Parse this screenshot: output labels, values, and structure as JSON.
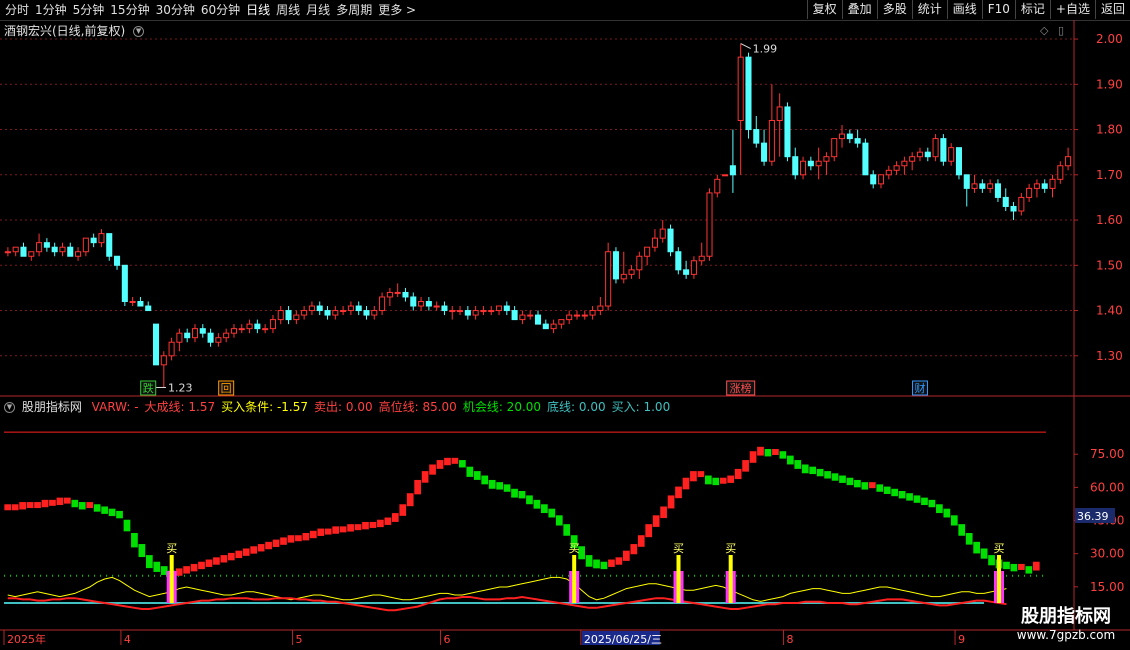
{
  "toolbar": {
    "periods": [
      "分时",
      "1分钟",
      "5分钟",
      "15分钟",
      "30分钟",
      "60分钟",
      "日线",
      "周线",
      "月线",
      "多周期",
      "更多 >"
    ],
    "active_period": "日线",
    "buttons": [
      "复权",
      "叠加",
      "多股",
      "统计",
      "画线",
      "F10",
      "标记",
      "+自选",
      "返回"
    ]
  },
  "stock_title": "酒钢宏兴(日线,前复权)",
  "colors": {
    "up": "#ff3333",
    "down": "#54ffff",
    "axis": "#b3282d",
    "grid": "#7a1a1a",
    "yellow": "#ffff00",
    "green": "#00e000",
    "red": "#ff2020",
    "magenta": "#ff33ff",
    "teal": "#40c0c0"
  },
  "indicator": {
    "name": "股朋指标网",
    "values": [
      {
        "text": "VARW: -",
        "color": "#ff4040"
      },
      {
        "text": "大成线: 1.57",
        "color": "#ff4040"
      },
      {
        "text": "买入条件: -1.57",
        "color": "#ffff00"
      },
      {
        "text": "卖出: 0.00",
        "color": "#ff4040"
      },
      {
        "text": "高位线: 85.00",
        "color": "#ff4040"
      },
      {
        "text": "机会线: 20.00",
        "color": "#00e000"
      },
      {
        "text": "底线: 0.00",
        "color": "#40c0c0"
      },
      {
        "text": "买入: 1.00",
        "color": "#40c0c0"
      }
    ]
  },
  "logo": {
    "line1": "股朋指标网",
    "line2": "www.7gpzb.com"
  },
  "chart_data": [
    {
      "type": "candlestick",
      "title": "酒钢宏兴(日线,前复权)",
      "ylim": [
        1.22,
        2.02
      ],
      "y_ticks": [
        "2.00",
        "1.90",
        "1.80",
        "1.70",
        "1.60",
        "1.50",
        "1.40",
        "1.30"
      ],
      "annotations": [
        {
          "text": "1.99",
          "x_index": 94
        },
        {
          "text": "1.23",
          "x_index": 19
        }
      ],
      "event_tags": [
        {
          "text": "跌",
          "x_index": 18,
          "color": "#33cc33"
        },
        {
          "text": "回",
          "x_index": 28,
          "color": "#ff9900"
        },
        {
          "text": "涨榜",
          "x_index": 94,
          "color": "#ff5050"
        },
        {
          "text": "财",
          "x_index": 117,
          "color": "#3399ff"
        }
      ],
      "ohlc": [
        [
          1.53,
          1.54,
          1.52,
          1.53
        ],
        [
          1.53,
          1.54,
          1.52,
          1.54
        ],
        [
          1.54,
          1.55,
          1.52,
          1.52
        ],
        [
          1.52,
          1.53,
          1.51,
          1.53
        ],
        [
          1.53,
          1.57,
          1.52,
          1.55
        ],
        [
          1.55,
          1.56,
          1.53,
          1.54
        ],
        [
          1.54,
          1.55,
          1.52,
          1.53
        ],
        [
          1.53,
          1.55,
          1.52,
          1.54
        ],
        [
          1.54,
          1.55,
          1.52,
          1.52
        ],
        [
          1.52,
          1.54,
          1.51,
          1.53
        ],
        [
          1.53,
          1.56,
          1.52,
          1.56
        ],
        [
          1.56,
          1.57,
          1.54,
          1.55
        ],
        [
          1.55,
          1.58,
          1.54,
          1.57
        ],
        [
          1.57,
          1.57,
          1.51,
          1.52
        ],
        [
          1.52,
          1.52,
          1.49,
          1.5
        ],
        [
          1.5,
          1.5,
          1.41,
          1.42
        ],
        [
          1.42,
          1.43,
          1.41,
          1.42
        ],
        [
          1.42,
          1.43,
          1.41,
          1.41
        ],
        [
          1.41,
          1.42,
          1.4,
          1.4
        ],
        [
          1.37,
          1.37,
          1.28,
          1.28
        ],
        [
          1.28,
          1.31,
          1.23,
          1.3
        ],
        [
          1.3,
          1.34,
          1.29,
          1.33
        ],
        [
          1.33,
          1.36,
          1.31,
          1.35
        ],
        [
          1.35,
          1.36,
          1.33,
          1.34
        ],
        [
          1.34,
          1.37,
          1.33,
          1.36
        ],
        [
          1.36,
          1.37,
          1.34,
          1.35
        ],
        [
          1.35,
          1.36,
          1.32,
          1.33
        ],
        [
          1.33,
          1.35,
          1.32,
          1.34
        ],
        [
          1.34,
          1.36,
          1.33,
          1.35
        ],
        [
          1.35,
          1.37,
          1.34,
          1.36
        ],
        [
          1.36,
          1.37,
          1.35,
          1.36
        ],
        [
          1.36,
          1.38,
          1.35,
          1.37
        ],
        [
          1.37,
          1.38,
          1.35,
          1.36
        ],
        [
          1.36,
          1.37,
          1.35,
          1.36
        ],
        [
          1.36,
          1.39,
          1.35,
          1.38
        ],
        [
          1.38,
          1.41,
          1.37,
          1.4
        ],
        [
          1.4,
          1.41,
          1.37,
          1.38
        ],
        [
          1.38,
          1.4,
          1.37,
          1.39
        ],
        [
          1.39,
          1.41,
          1.38,
          1.4
        ],
        [
          1.4,
          1.42,
          1.39,
          1.41
        ],
        [
          1.41,
          1.42,
          1.39,
          1.4
        ],
        [
          1.4,
          1.41,
          1.38,
          1.39
        ],
        [
          1.39,
          1.41,
          1.38,
          1.4
        ],
        [
          1.4,
          1.41,
          1.39,
          1.4
        ],
        [
          1.4,
          1.42,
          1.39,
          1.41
        ],
        [
          1.41,
          1.42,
          1.39,
          1.4
        ],
        [
          1.4,
          1.41,
          1.38,
          1.39
        ],
        [
          1.39,
          1.41,
          1.38,
          1.4
        ],
        [
          1.4,
          1.44,
          1.39,
          1.43
        ],
        [
          1.43,
          1.45,
          1.41,
          1.44
        ],
        [
          1.44,
          1.46,
          1.43,
          1.44
        ],
        [
          1.44,
          1.45,
          1.42,
          1.43
        ],
        [
          1.43,
          1.44,
          1.4,
          1.41
        ],
        [
          1.41,
          1.43,
          1.4,
          1.42
        ],
        [
          1.42,
          1.43,
          1.4,
          1.41
        ],
        [
          1.41,
          1.42,
          1.4,
          1.41
        ],
        [
          1.41,
          1.42,
          1.39,
          1.4
        ],
        [
          1.4,
          1.41,
          1.38,
          1.4
        ],
        [
          1.4,
          1.41,
          1.39,
          1.4
        ],
        [
          1.4,
          1.41,
          1.38,
          1.39
        ],
        [
          1.39,
          1.41,
          1.38,
          1.4
        ],
        [
          1.4,
          1.41,
          1.39,
          1.4
        ],
        [
          1.4,
          1.41,
          1.39,
          1.4
        ],
        [
          1.4,
          1.41,
          1.39,
          1.41
        ],
        [
          1.41,
          1.42,
          1.39,
          1.4
        ],
        [
          1.4,
          1.41,
          1.38,
          1.38
        ],
        [
          1.38,
          1.4,
          1.37,
          1.39
        ],
        [
          1.39,
          1.4,
          1.38,
          1.39
        ],
        [
          1.39,
          1.4,
          1.37,
          1.37
        ],
        [
          1.37,
          1.38,
          1.36,
          1.36
        ],
        [
          1.36,
          1.38,
          1.35,
          1.37
        ],
        [
          1.37,
          1.38,
          1.36,
          1.38
        ],
        [
          1.38,
          1.4,
          1.37,
          1.39
        ],
        [
          1.39,
          1.4,
          1.38,
          1.39
        ],
        [
          1.39,
          1.4,
          1.38,
          1.39
        ],
        [
          1.39,
          1.41,
          1.38,
          1.4
        ],
        [
          1.4,
          1.43,
          1.39,
          1.41
        ],
        [
          1.41,
          1.55,
          1.4,
          1.53
        ],
        [
          1.53,
          1.54,
          1.46,
          1.47
        ],
        [
          1.47,
          1.53,
          1.46,
          1.48
        ],
        [
          1.48,
          1.5,
          1.47,
          1.49
        ],
        [
          1.49,
          1.53,
          1.47,
          1.52
        ],
        [
          1.52,
          1.54,
          1.5,
          1.54
        ],
        [
          1.54,
          1.58,
          1.53,
          1.56
        ],
        [
          1.56,
          1.6,
          1.55,
          1.58
        ],
        [
          1.58,
          1.59,
          1.52,
          1.53
        ],
        [
          1.53,
          1.54,
          1.48,
          1.49
        ],
        [
          1.49,
          1.51,
          1.47,
          1.48
        ],
        [
          1.48,
          1.52,
          1.47,
          1.51
        ],
        [
          1.51,
          1.55,
          1.5,
          1.52
        ],
        [
          1.52,
          1.67,
          1.51,
          1.66
        ],
        [
          1.66,
          1.7,
          1.65,
          1.69
        ],
        [
          1.7,
          1.7,
          1.7,
          1.7
        ],
        [
          1.72,
          1.8,
          1.66,
          1.7
        ],
        [
          1.82,
          1.99,
          1.7,
          1.96
        ],
        [
          1.96,
          1.97,
          1.78,
          1.8
        ],
        [
          1.8,
          1.83,
          1.76,
          1.77
        ],
        [
          1.77,
          1.8,
          1.72,
          1.73
        ],
        [
          1.73,
          1.9,
          1.72,
          1.82
        ],
        [
          1.82,
          1.88,
          1.74,
          1.85
        ],
        [
          1.85,
          1.86,
          1.73,
          1.74
        ],
        [
          1.74,
          1.76,
          1.69,
          1.7
        ],
        [
          1.7,
          1.74,
          1.69,
          1.73
        ],
        [
          1.73,
          1.74,
          1.71,
          1.72
        ],
        [
          1.72,
          1.76,
          1.69,
          1.73
        ],
        [
          1.73,
          1.75,
          1.7,
          1.74
        ],
        [
          1.74,
          1.78,
          1.73,
          1.78
        ],
        [
          1.78,
          1.81,
          1.76,
          1.79
        ],
        [
          1.79,
          1.8,
          1.77,
          1.78
        ],
        [
          1.78,
          1.8,
          1.76,
          1.77
        ],
        [
          1.77,
          1.78,
          1.7,
          1.7
        ],
        [
          1.7,
          1.71,
          1.67,
          1.68
        ],
        [
          1.68,
          1.7,
          1.67,
          1.7
        ],
        [
          1.7,
          1.72,
          1.69,
          1.71
        ],
        [
          1.71,
          1.73,
          1.7,
          1.72
        ],
        [
          1.72,
          1.74,
          1.7,
          1.73
        ],
        [
          1.73,
          1.75,
          1.71,
          1.74
        ],
        [
          1.74,
          1.76,
          1.73,
          1.75
        ],
        [
          1.75,
          1.76,
          1.73,
          1.74
        ],
        [
          1.74,
          1.79,
          1.73,
          1.78
        ],
        [
          1.78,
          1.79,
          1.72,
          1.73
        ],
        [
          1.73,
          1.77,
          1.72,
          1.76
        ],
        [
          1.76,
          1.76,
          1.69,
          1.7
        ],
        [
          1.7,
          1.7,
          1.63,
          1.67
        ],
        [
          1.67,
          1.7,
          1.66,
          1.68
        ],
        [
          1.68,
          1.69,
          1.66,
          1.67
        ],
        [
          1.67,
          1.69,
          1.66,
          1.68
        ],
        [
          1.68,
          1.69,
          1.64,
          1.65
        ],
        [
          1.65,
          1.67,
          1.62,
          1.63
        ],
        [
          1.63,
          1.64,
          1.6,
          1.62
        ],
        [
          1.62,
          1.66,
          1.61,
          1.65
        ],
        [
          1.65,
          1.68,
          1.64,
          1.67
        ],
        [
          1.67,
          1.69,
          1.65,
          1.68
        ],
        [
          1.68,
          1.69,
          1.66,
          1.67
        ],
        [
          1.67,
          1.7,
          1.65,
          1.69
        ],
        [
          1.69,
          1.73,
          1.68,
          1.72
        ],
        [
          1.72,
          1.76,
          1.71,
          1.74
        ]
      ]
    },
    {
      "type": "indicator",
      "name": "股朋指标网",
      "ylim": [
        0,
        95
      ],
      "y_ticks": [
        "75.00",
        "60.00",
        "45.00",
        "30.00",
        "15.00"
      ],
      "current_value_label": "36.39",
      "reference_lines": [
        {
          "name": "高位线",
          "value": 85
        },
        {
          "name": "机会线",
          "value": 20
        },
        {
          "name": "底线",
          "value": 0
        }
      ],
      "signal_label": "买",
      "buy_signals": [
        22,
        76,
        90,
        97,
        133
      ],
      "x_labels": [
        {
          "text": "2025年",
          "x_index": 0
        },
        {
          "text": "4",
          "x_index": 15
        },
        {
          "text": "5",
          "x_index": 37
        },
        {
          "text": "6",
          "x_index": 56
        },
        {
          "text": "2025/06/25/三",
          "x_index": 74
        },
        {
          "text": "8",
          "x_index": 100
        },
        {
          "text": "9",
          "x_index": 122
        }
      ],
      "main_line": [
        51,
        51,
        52,
        52,
        52,
        53,
        53,
        54,
        54,
        53,
        52,
        52,
        51,
        50,
        49,
        48,
        44,
        38,
        33,
        28,
        25,
        23,
        21,
        22,
        23,
        24,
        25,
        26,
        27,
        28,
        29,
        30,
        31,
        32,
        33,
        34,
        35,
        36,
        37,
        37,
        38,
        39,
        40,
        40,
        41,
        41,
        42,
        42,
        43,
        43,
        44,
        45,
        47,
        51,
        56,
        62,
        66,
        69,
        71,
        72,
        72,
        71,
        68,
        66,
        64,
        62,
        61,
        60,
        58,
        57,
        55,
        53,
        51,
        49,
        46,
        42,
        37,
        32,
        28,
        26,
        25,
        26,
        27,
        30,
        33,
        37,
        42,
        46,
        50,
        55,
        59,
        63,
        66,
        66,
        64,
        63,
        63,
        64,
        67,
        71,
        75,
        77,
        76,
        76,
        75,
        73,
        71,
        69,
        68,
        67,
        66,
        65,
        64,
        63,
        62,
        61,
        61,
        60,
        59,
        58,
        57,
        56,
        55,
        54,
        53,
        51,
        49,
        46,
        42,
        38,
        34,
        31,
        28,
        26,
        25,
        24,
        24,
        23,
        25
      ],
      "yellow_line": [
        5,
        4,
        5,
        6,
        7,
        6,
        5,
        4,
        5,
        6,
        8,
        10,
        13,
        15,
        16,
        14,
        11,
        8,
        6,
        4,
        5,
        6,
        7,
        9,
        10,
        9,
        8,
        7,
        6,
        5,
        5,
        6,
        7,
        7,
        6,
        5,
        4,
        3,
        2,
        3,
        4,
        5,
        5,
        4,
        3,
        2,
        2,
        3,
        4,
        5,
        5,
        4,
        3,
        2,
        2,
        3,
        4,
        5,
        6,
        6,
        5,
        5,
        6,
        7,
        8,
        9,
        10,
        10,
        11,
        12,
        13,
        14,
        15,
        16,
        16,
        15,
        12,
        8,
        4,
        2,
        3,
        5,
        7,
        9,
        10,
        11,
        12,
        12,
        11,
        10,
        9,
        8,
        8,
        9,
        10,
        11,
        10,
        8,
        6,
        4,
        2,
        1,
        2,
        3,
        4,
        6,
        7,
        8,
        9,
        9,
        8,
        7,
        6,
        6,
        7,
        8,
        9,
        10,
        10,
        9,
        8,
        7,
        6,
        5,
        4,
        4,
        5,
        6,
        7,
        7,
        6,
        6,
        7,
        8,
        9
      ],
      "red_line": [
        1,
        1,
        2,
        2,
        3,
        3,
        2,
        2,
        1,
        1,
        2,
        3,
        4,
        5,
        6,
        7,
        8,
        9,
        10,
        10,
        9,
        8,
        7,
        6,
        5,
        4,
        3,
        3,
        2,
        2,
        1,
        1,
        1,
        2,
        2,
        2,
        1,
        1,
        1,
        2,
        2,
        3,
        3,
        4,
        4,
        5,
        6,
        7,
        8,
        9,
        10,
        11,
        11,
        10,
        9,
        8,
        6,
        4,
        2,
        1,
        1,
        0,
        0,
        1,
        2,
        2,
        2,
        1,
        1,
        0,
        1,
        2,
        3,
        4,
        5,
        6,
        7,
        8,
        9,
        9,
        8,
        7,
        6,
        5,
        4,
        3,
        2,
        1,
        1,
        2,
        3,
        4,
        5,
        6,
        7,
        8,
        9,
        10,
        10,
        9,
        8,
        7,
        6,
        6,
        5,
        5,
        5,
        4,
        4,
        4,
        5,
        5,
        5,
        6,
        6,
        5,
        4,
        3,
        2,
        2,
        2,
        3,
        4,
        5,
        6,
        7,
        7,
        6,
        5,
        4,
        3,
        3,
        4,
        5,
        6
      ]
    }
  ]
}
